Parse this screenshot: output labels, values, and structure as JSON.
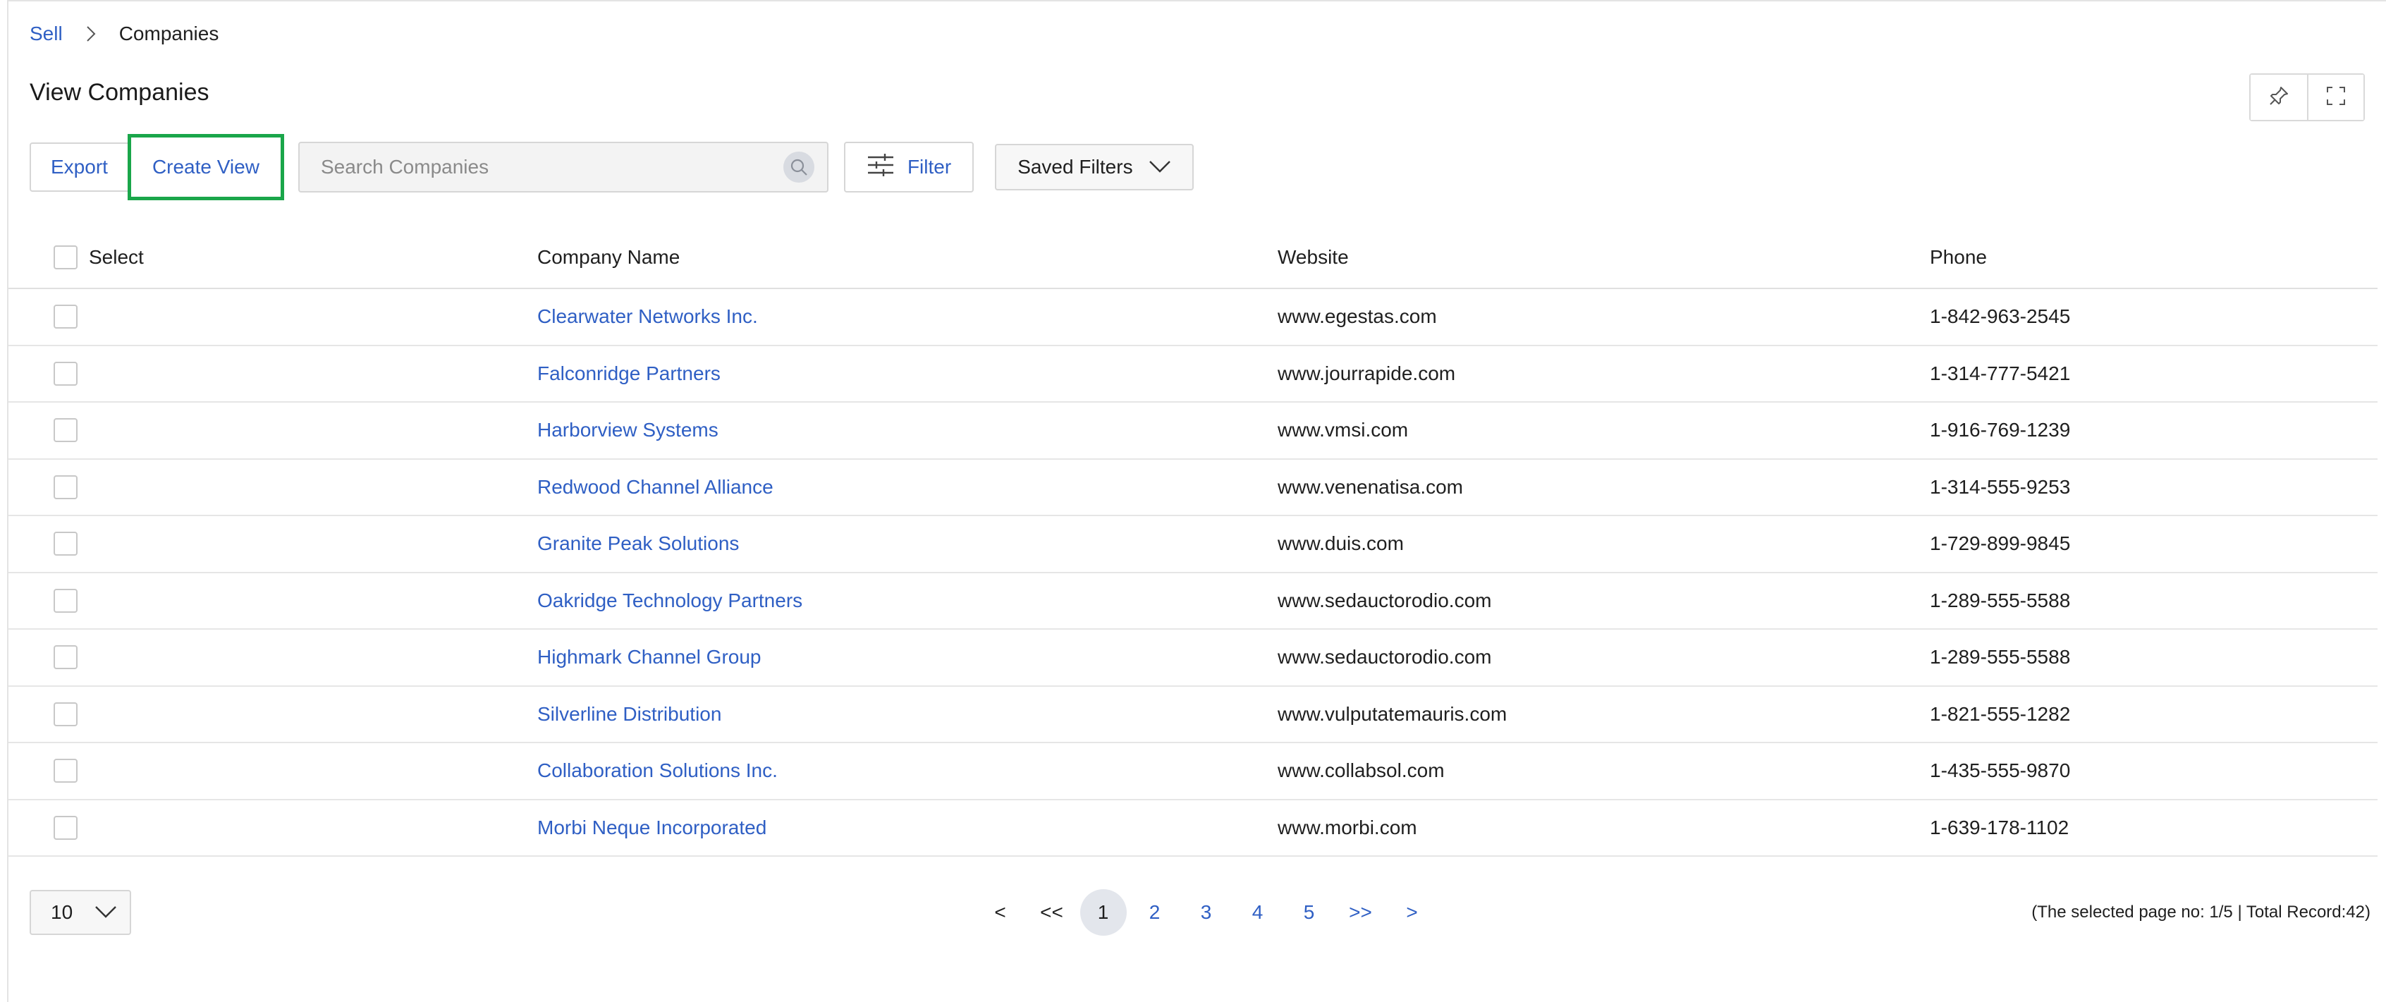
{
  "breadcrumb": {
    "root": "Sell",
    "current": "Companies"
  },
  "page_title": "View Companies",
  "toolbar": {
    "export_label": "Export",
    "create_view_label": "Create View",
    "search_placeholder": "Search Companies",
    "filter_label": "Filter",
    "saved_filters_label": "Saved Filters"
  },
  "table": {
    "headers": {
      "select": "Select",
      "name": "Company Name",
      "website": "Website",
      "phone": "Phone"
    },
    "rows": [
      {
        "name": "Clearwater Networks Inc.",
        "website": "www.egestas.com",
        "phone": "1-842-963-2545"
      },
      {
        "name": "Falconridge Partners",
        "website": "www.jourrapide.com",
        "phone": "1-314-777-5421"
      },
      {
        "name": "Harborview Systems",
        "website": "www.vmsi.com",
        "phone": "1-916-769-1239"
      },
      {
        "name": "Redwood Channel Alliance",
        "website": "www.venenatisa.com",
        "phone": "1-314-555-9253"
      },
      {
        "name": "Granite Peak Solutions",
        "website": "www.duis.com",
        "phone": "1-729-899-9845"
      },
      {
        "name": "Oakridge Technology Partners",
        "website": "www.sedauctorodio.com",
        "phone": "1-289-555-5588"
      },
      {
        "name": "Highmark Channel Group",
        "website": "www.sedauctorodio.com",
        "phone": "1-289-555-5588"
      },
      {
        "name": "Silverline Distribution",
        "website": "www.vulputatemauris.com",
        "phone": "1-821-555-1282"
      },
      {
        "name": "Collaboration Solutions Inc.",
        "website": "www.collabsol.com",
        "phone": "1-435-555-9870"
      },
      {
        "name": "Morbi Neque Incorporated",
        "website": "www.morbi.com",
        "phone": "1-639-178-1102"
      }
    ]
  },
  "pagination": {
    "page_size": "10",
    "prev": "<",
    "first": "<<",
    "pages": [
      "1",
      "2",
      "3",
      "4",
      "5"
    ],
    "last": ">>",
    "next": ">",
    "summary": "(The selected page no: 1/5 | Total Record:42)"
  },
  "colors": {
    "accent": "#2f5fc4",
    "highlight_border": "#1aa64a"
  },
  "icons": [
    "chevron-right-icon",
    "pin-icon",
    "fullscreen-icon",
    "search-icon",
    "sliders-icon",
    "chevron-down-icon"
  ]
}
